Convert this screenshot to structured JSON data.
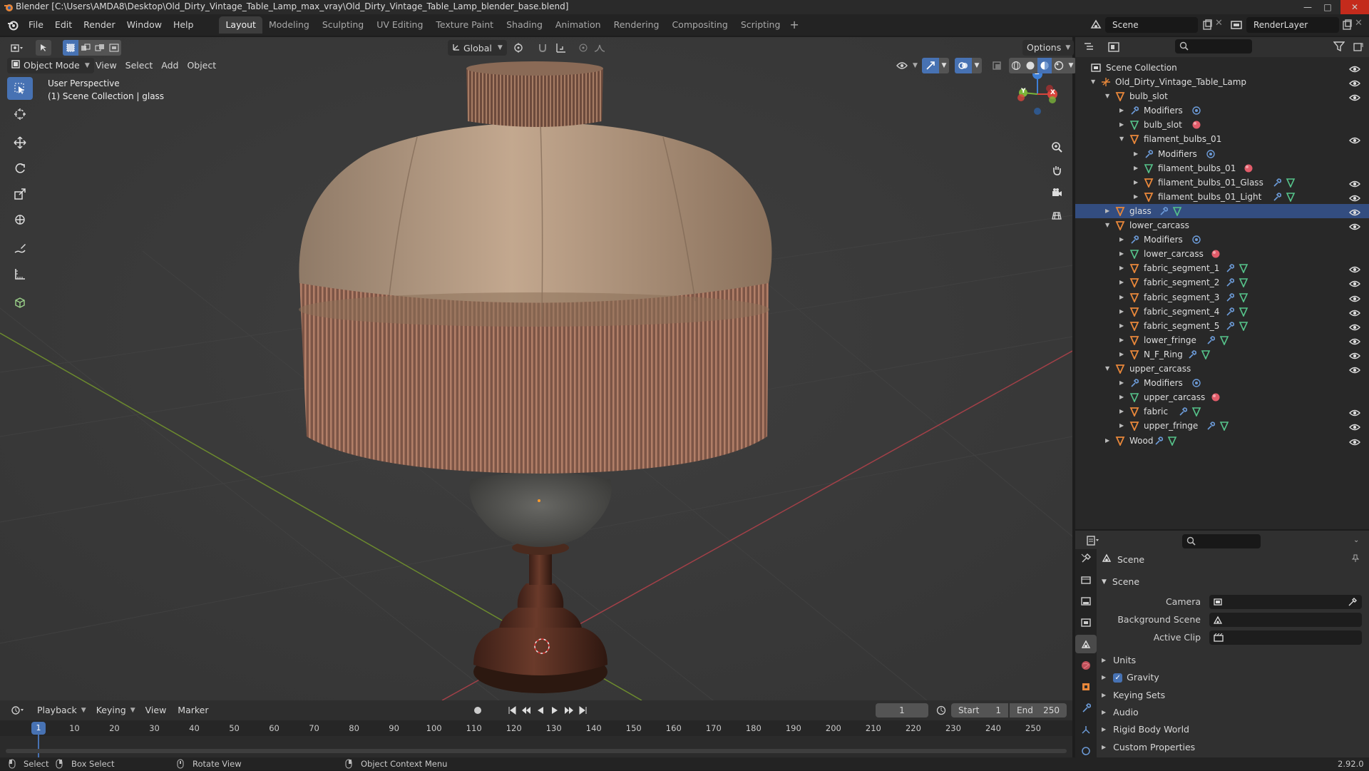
{
  "window": {
    "title": "Blender [C:\\Users\\AMDA8\\Desktop\\Old_Dirty_Vintage_Table_Lamp_max_vray\\Old_Dirty_Vintage_Table_Lamp_blender_base.blend]"
  },
  "menu": [
    "File",
    "Edit",
    "Render",
    "Window",
    "Help"
  ],
  "workspaces": [
    {
      "label": "Layout",
      "active": true
    },
    {
      "label": "Modeling"
    },
    {
      "label": "Sculpting"
    },
    {
      "label": "UV Editing"
    },
    {
      "label": "Texture Paint"
    },
    {
      "label": "Shading"
    },
    {
      "label": "Animation"
    },
    {
      "label": "Rendering"
    },
    {
      "label": "Compositing"
    },
    {
      "label": "Scripting"
    }
  ],
  "add_workspace": "+",
  "scene_field": "Scene",
  "render_layer_field": "RenderLayer",
  "viewport_header": {
    "transform_orientation": "Global",
    "options": "Options",
    "mode": "Object Mode",
    "menus": [
      "View",
      "Select",
      "Add",
      "Object"
    ]
  },
  "viewport_overlay": {
    "line1": "User Perspective",
    "line2": "(1) Scene Collection | glass"
  },
  "gizmo": {
    "x": "X",
    "y": "Y",
    "z": "Z"
  },
  "outliner": {
    "root": "Scene Collection",
    "items": [
      {
        "label": "Old_Dirty_Vintage_Table_Lamp",
        "indent": 1,
        "icon": "empty",
        "expanded": true,
        "eye": true
      },
      {
        "label": "bulb_slot",
        "indent": 2,
        "icon": "object",
        "expanded": true,
        "eye": true
      },
      {
        "label": "Modifiers",
        "indent": 3,
        "icon": "wrench",
        "extra": "modifier",
        "eye": false
      },
      {
        "label": "bulb_slot",
        "indent": 3,
        "icon": "mesh",
        "extra": "material",
        "eye": false
      },
      {
        "label": "filament_bulbs_01",
        "indent": 3,
        "icon": "object",
        "expanded": true,
        "eye": true
      },
      {
        "label": "Modifiers",
        "indent": 4,
        "icon": "wrench",
        "extra": "modifier",
        "eye": false
      },
      {
        "label": "filament_bulbs_01",
        "indent": 4,
        "icon": "mesh",
        "extra": "material",
        "eye": false
      },
      {
        "label": "filament_bulbs_01_Glass",
        "indent": 4,
        "icon": "object",
        "extra": "wrench-mesh",
        "eye": true
      },
      {
        "label": "filament_bulbs_01_Light",
        "indent": 4,
        "icon": "object",
        "extra": "wrench-mesh",
        "eye": true
      },
      {
        "label": "glass",
        "indent": 2,
        "icon": "object",
        "extra": "wrench-mesh",
        "eye": true,
        "selected": true
      },
      {
        "label": "lower_carcass",
        "indent": 2,
        "icon": "object",
        "expanded": true,
        "eye": true
      },
      {
        "label": "Modifiers",
        "indent": 3,
        "icon": "wrench",
        "extra": "modifier",
        "eye": false
      },
      {
        "label": "lower_carcass",
        "indent": 3,
        "icon": "mesh",
        "extra": "material",
        "eye": false
      },
      {
        "label": "fabric_segment_1",
        "indent": 3,
        "icon": "object",
        "extra": "wrench-mesh",
        "eye": true
      },
      {
        "label": "fabric_segment_2",
        "indent": 3,
        "icon": "object",
        "extra": "wrench-mesh",
        "eye": true
      },
      {
        "label": "fabric_segment_3",
        "indent": 3,
        "icon": "object",
        "extra": "wrench-mesh",
        "eye": true
      },
      {
        "label": "fabric_segment_4",
        "indent": 3,
        "icon": "object",
        "extra": "wrench-mesh",
        "eye": true
      },
      {
        "label": "fabric_segment_5",
        "indent": 3,
        "icon": "object",
        "extra": "wrench-mesh",
        "eye": true
      },
      {
        "label": "lower_fringe",
        "indent": 3,
        "icon": "object",
        "extra": "wrench-mesh",
        "eye": true
      },
      {
        "label": "N_F_Ring",
        "indent": 3,
        "icon": "object",
        "extra": "wrench-mesh",
        "eye": true
      },
      {
        "label": "upper_carcass",
        "indent": 2,
        "icon": "object",
        "expanded": true,
        "eye": true
      },
      {
        "label": "Modifiers",
        "indent": 3,
        "icon": "wrench",
        "extra": "modifier",
        "eye": false
      },
      {
        "label": "upper_carcass",
        "indent": 3,
        "icon": "mesh",
        "extra": "material",
        "eye": false
      },
      {
        "label": "fabric",
        "indent": 3,
        "icon": "object",
        "extra": "wrench-mesh",
        "eye": true
      },
      {
        "label": "upper_fringe",
        "indent": 3,
        "icon": "object",
        "extra": "wrench-mesh",
        "eye": true
      },
      {
        "label": "Wood",
        "indent": 2,
        "icon": "object",
        "extra": "wrench-mesh",
        "eye": true
      }
    ]
  },
  "properties": {
    "context": "Scene",
    "panel": "Scene",
    "fields": [
      {
        "label": "Camera",
        "value": ""
      },
      {
        "label": "Background Scene",
        "value": ""
      },
      {
        "label": "Active Clip",
        "value": ""
      }
    ],
    "sections": [
      {
        "label": "Units"
      },
      {
        "label": "Gravity",
        "checkbox": true
      },
      {
        "label": "Keying Sets"
      },
      {
        "label": "Audio"
      },
      {
        "label": "Rigid Body World"
      },
      {
        "label": "Custom Properties"
      }
    ]
  },
  "timeline": {
    "menus": [
      "Playback",
      "Keying",
      "View",
      "Marker"
    ],
    "current_frame": "1",
    "start_label": "Start",
    "start": "1",
    "end_label": "End",
    "end": "250",
    "ticks": [
      "1",
      "10",
      "20",
      "30",
      "40",
      "50",
      "60",
      "70",
      "80",
      "90",
      "100",
      "110",
      "120",
      "130",
      "140",
      "150",
      "160",
      "170",
      "180",
      "190",
      "200",
      "210",
      "220",
      "230",
      "240",
      "250"
    ]
  },
  "statusbar": {
    "select": "Select",
    "box_select": "Box Select",
    "rotate": "Rotate View",
    "context_menu": "Object Context Menu",
    "version": "2.92.0"
  },
  "colors": {
    "accent": "#4772b3",
    "object_orange": "#e8873a",
    "mesh_green": "#56c48b",
    "material_red": "#e25c6a",
    "modifier_blue": "#6c9bd8"
  }
}
